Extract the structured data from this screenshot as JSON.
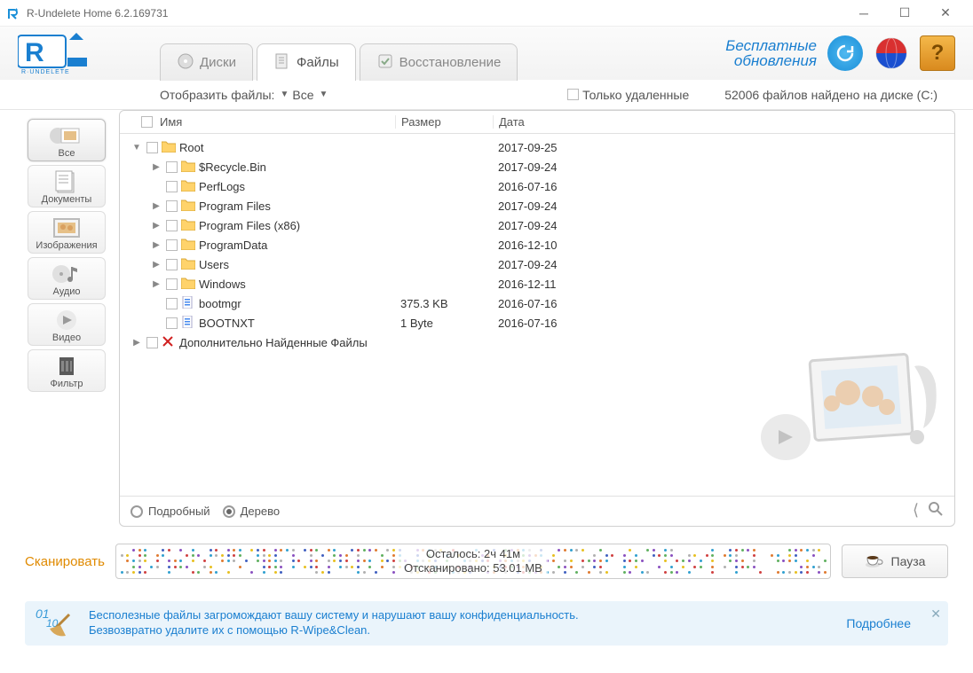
{
  "window": {
    "title": "R-Undelete Home 6.2.169731"
  },
  "logo_sub": "R·UNDELETE",
  "tabs": {
    "disks": "Диски",
    "files": "Файлы",
    "recovery": "Восстановление"
  },
  "header": {
    "updates_line1": "Бесплатные",
    "updates_line2": "обновления"
  },
  "filter": {
    "show_label": "Отобразить файлы:",
    "all": "Все",
    "deleted_only": "Только удаленные",
    "found_status": "52006 файлов  найдено на диске (C:)"
  },
  "categories": [
    {
      "id": "all",
      "label": "Все"
    },
    {
      "id": "docs",
      "label": "Документы"
    },
    {
      "id": "images",
      "label": "Изображения"
    },
    {
      "id": "audio",
      "label": "Аудио"
    },
    {
      "id": "video",
      "label": "Видео"
    },
    {
      "id": "filter",
      "label": "Фильтр"
    }
  ],
  "columns": {
    "name": "Имя",
    "size": "Размер",
    "date": "Дата"
  },
  "rows": [
    {
      "level": 0,
      "expander": "down",
      "icon": "folder",
      "name": "Root",
      "size": "",
      "date": "2017-09-25"
    },
    {
      "level": 1,
      "expander": "right",
      "icon": "folder",
      "name": "$Recycle.Bin",
      "size": "",
      "date": "2017-09-24"
    },
    {
      "level": 1,
      "expander": "none",
      "icon": "folder",
      "name": "PerfLogs",
      "size": "",
      "date": "2016-07-16"
    },
    {
      "level": 1,
      "expander": "right",
      "icon": "folder",
      "name": "Program Files",
      "size": "",
      "date": "2017-09-24"
    },
    {
      "level": 1,
      "expander": "right",
      "icon": "folder",
      "name": "Program Files (x86)",
      "size": "",
      "date": "2017-09-24"
    },
    {
      "level": 1,
      "expander": "right",
      "icon": "folder",
      "name": "ProgramData",
      "size": "",
      "date": "2016-12-10"
    },
    {
      "level": 1,
      "expander": "right",
      "icon": "folder",
      "name": "Users",
      "size": "",
      "date": "2017-09-24"
    },
    {
      "level": 1,
      "expander": "right",
      "icon": "folder",
      "name": "Windows",
      "size": "",
      "date": "2016-12-11"
    },
    {
      "level": 1,
      "expander": "none",
      "icon": "file",
      "name": "bootmgr",
      "size": "375.3 KB",
      "date": "2016-07-16"
    },
    {
      "level": 1,
      "expander": "none",
      "icon": "file",
      "name": "BOOTNXT",
      "size": "1 Byte",
      "date": "2016-07-16"
    },
    {
      "level": 0,
      "expander": "right",
      "icon": "extra",
      "name": "Дополнительно Найденные Файлы",
      "size": "",
      "date": ""
    }
  ],
  "view": {
    "detailed": "Подробный",
    "tree": "Дерево"
  },
  "scan": {
    "scan_label": "Сканировать",
    "remaining": "Осталось: 2ч 41м",
    "scanned": "Отсканировано: 53.01 MB",
    "pause": "Пауза"
  },
  "promo": {
    "line1": "Бесполезные файлы загромождают вашу систему и нарушают вашу конфиденциальность.",
    "line2": "Безвозвратно удалите их с помощью R-Wipe&Clean.",
    "more": "Подробнее"
  }
}
